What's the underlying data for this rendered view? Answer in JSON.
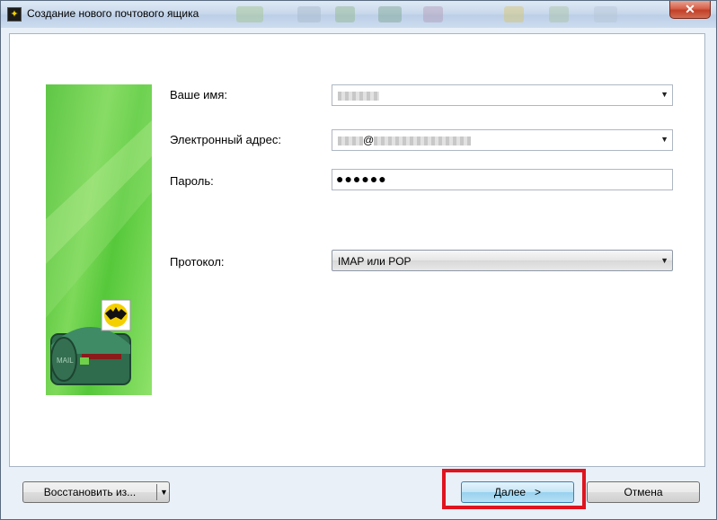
{
  "window": {
    "title": "Создание нового почтового ящика",
    "close_glyph": "✕"
  },
  "form": {
    "name_label": "Ваше имя:",
    "name_value": "",
    "email_label": "Электронный адрес:",
    "email_at": "@",
    "password_label": "Пароль:",
    "password_mask": "●●●●●●",
    "protocol_label": "Протокол:",
    "protocol_value": "IMAP или POP"
  },
  "buttons": {
    "restore_label": "Восстановить из...",
    "next_label": "Далее   >",
    "cancel_label": "Отмена"
  },
  "banner": {
    "mailbox_text": "MAIL"
  },
  "icons": {
    "dropdown": "▼",
    "app": "🦇"
  },
  "colors": {
    "highlight": "#e0141e",
    "banner_green": "#56c83a"
  }
}
